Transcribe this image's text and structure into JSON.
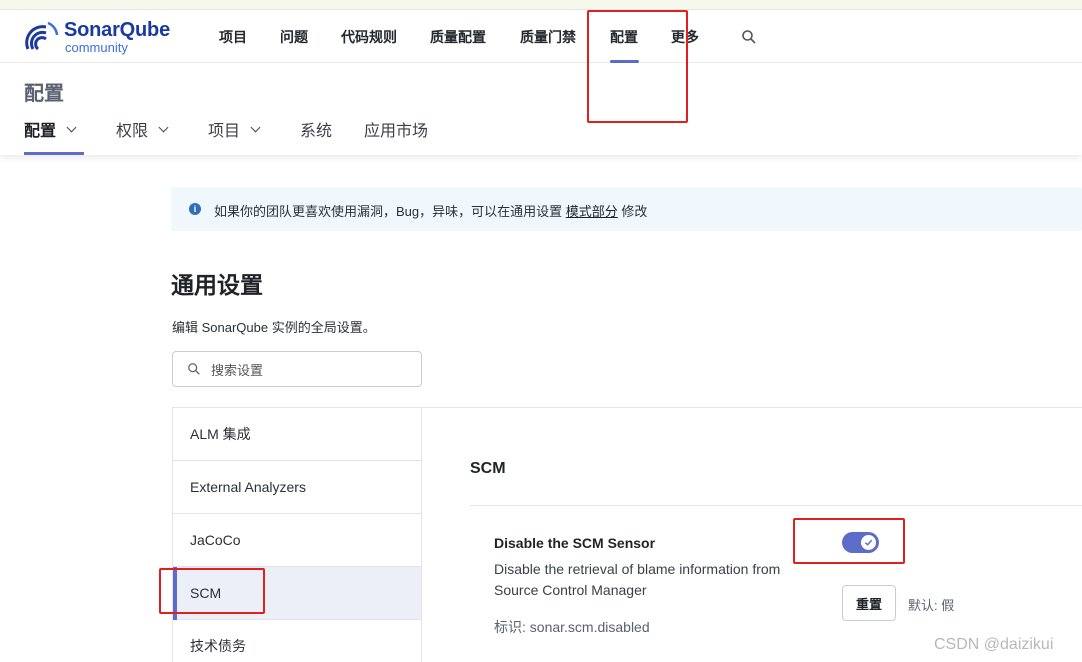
{
  "brand": {
    "name": "SonarQube",
    "edition": "community"
  },
  "topnav": {
    "items": [
      "项目",
      "问题",
      "代码规则",
      "质量配置",
      "质量门禁",
      "配置",
      "更多"
    ],
    "active": "配置"
  },
  "page": {
    "title": "配置"
  },
  "subnav": {
    "items": [
      {
        "label": "配置",
        "dropdown": true
      },
      {
        "label": "权限",
        "dropdown": true
      },
      {
        "label": "项目",
        "dropdown": true
      },
      {
        "label": "系统",
        "dropdown": false
      },
      {
        "label": "应用市场",
        "dropdown": false
      }
    ]
  },
  "banner": {
    "text_before": "如果你的团队更喜欢使用漏洞，Bug，异味，可以在通用设置 ",
    "link": "模式部分",
    "text_after": " 修改"
  },
  "general": {
    "title": "通用设置",
    "description": "编辑 SonarQube 实例的全局设置。",
    "search_placeholder": "搜索设置"
  },
  "categories": [
    "ALM 集成",
    "External Analyzers",
    "JaCoCo",
    "SCM",
    "技术债务"
  ],
  "active_category": "SCM",
  "section": {
    "title": "SCM"
  },
  "setting": {
    "name": "Disable the SCM Sensor",
    "description": "Disable the retrieval of blame information from Source Control Manager",
    "key_label": "标识:",
    "key": "sonar.scm.disabled",
    "enabled": true,
    "reset_label": "重置",
    "default_label": "默认: 假"
  },
  "watermark": "CSDN @daizikui",
  "colors": {
    "accent": "#5d6cc9",
    "brand": "#1b3aa0",
    "annotation": "#e0201c"
  }
}
